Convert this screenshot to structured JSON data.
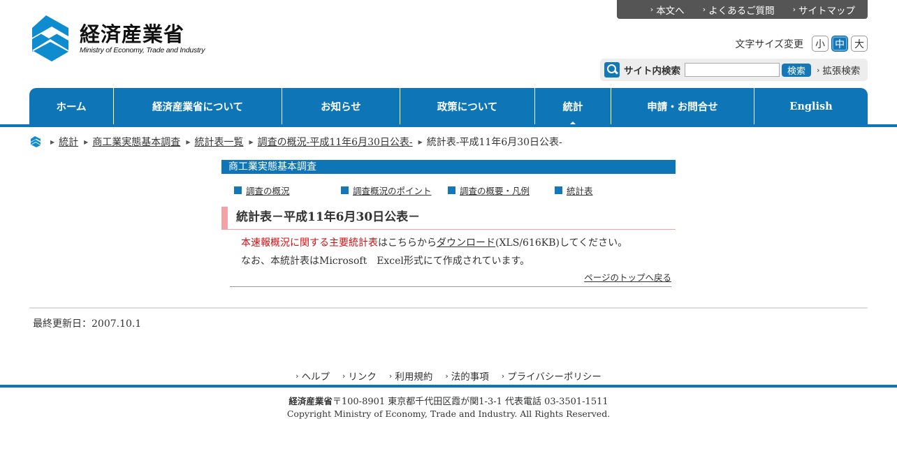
{
  "header": {
    "logo_ja": "経済産業省",
    "logo_en": "Ministry of Economy, Trade and Industry",
    "util_links": [
      "本文へ",
      "よくあるご質問",
      "サイトマップ"
    ],
    "font_size_label": "文字サイズ変更",
    "font_sizes": [
      "小",
      "中",
      "大"
    ],
    "font_size_selected": "中",
    "search": {
      "label": "サイト内検索",
      "value": "",
      "button": "検索",
      "advanced": "拡張検索"
    }
  },
  "nav": {
    "items": [
      "ホーム",
      "経済産業省について",
      "お知らせ",
      "政策について",
      "統計",
      "申請・お問合せ",
      "English"
    ],
    "current": "統計"
  },
  "breadcrumb": {
    "items": [
      "統計",
      "商工業実態基本調査",
      "統計表一覧",
      "調査の概況-平成11年6月30日公表-"
    ],
    "current": "統計表-平成11年6月30日公表-"
  },
  "main": {
    "section_title": "商工業実態基本調査",
    "subnav": [
      "調査の概況",
      "調査概況のポイント",
      "調査の概要・凡例",
      "統計表"
    ],
    "heading": "統計表－平成11年6月30日公表－",
    "para1_red": "本速報概況に関する主要統計表",
    "para1_mid": "はこちらから",
    "para1_link": "ダウンロード",
    "para1_end": "(XLS/616KB)してください。",
    "para2": "なお、本統計表はMicrosoft　Excel形式にて作成されています。",
    "to_top": "ページのトップへ戻る"
  },
  "updated": "最終更新日：2007.10.1",
  "footer": {
    "links": [
      "ヘルプ",
      "リンク",
      "利用規約",
      "法的事項",
      "プライバシーポリシー"
    ],
    "org": "経済産業省",
    "address": "〒100-8901 東京都千代田区霞が関1-3-1 代表電話 03-3501-1511",
    "copyright": "Copyright Ministry of Economy, Trade and Industry. All Rights Reserved."
  },
  "colors": {
    "brand_blue": "#0e76b6",
    "heading_accent": "#f3a3a6",
    "alert_red": "#d40f0f"
  }
}
